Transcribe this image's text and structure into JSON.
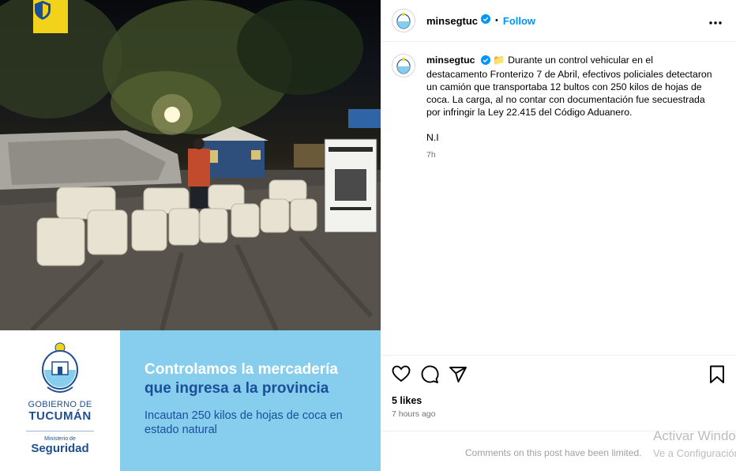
{
  "media": {
    "badge_icon": "shield-icon",
    "gov_line1": "GOBIERNO DE",
    "gov_line2": "TUCUMÁN",
    "ministry_line1": "Ministerio de",
    "ministry_line2": "Seguridad",
    "headline_line1": "Controlamos la mercadería",
    "headline_line2": "que ingresa a la provincia",
    "subheadline": "Incautan 250 kilos de hojas de coca en estado natural",
    "colors": {
      "banner_blue": "#86cdee",
      "brand_navy": "#1a4f98",
      "badge_yellow": "#f3d21b"
    }
  },
  "header": {
    "username": "minsegtuc",
    "separator": "•",
    "follow_label": "Follow",
    "more_icon": "more-horizontal-icon"
  },
  "caption": {
    "username": "minsegtuc",
    "emoji": "📁",
    "text": "Durante un control vehicular en el destacamento Fronterizo 7 de Abril, efectivos policiales detectaron un camión que transportaba 12 bultos con 250 kilos de hojas de coca. La carga, al no contar con documentación fue secuestrada por infringir la Ley 22.415 del Código Aduanero.",
    "signature": "N.I",
    "timestamp": "7h"
  },
  "actions": {
    "like_icon": "heart-icon",
    "comment_icon": "comment-icon",
    "share_icon": "share-icon",
    "save_icon": "bookmark-icon"
  },
  "stats": {
    "likes": "5 likes",
    "posted": "7 hours ago"
  },
  "footer": {
    "comments_limited": "Comments on this post have been limited."
  },
  "watermark": {
    "line1": "Activar Windows",
    "line2": "Ve a Configuración"
  }
}
